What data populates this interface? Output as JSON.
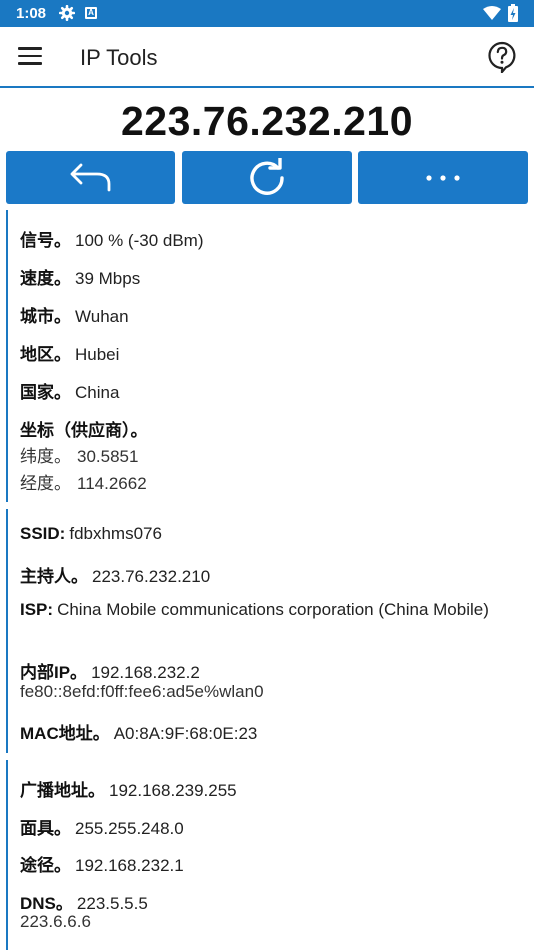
{
  "status_bar": {
    "time": "1:08",
    "icons": [
      "gear-icon",
      "a-notification-icon",
      "wifi-icon",
      "battery-icon"
    ]
  },
  "app_bar": {
    "title": "IP Tools",
    "menu_icon": "hamburger-menu-icon",
    "help_icon": "help-bubble-icon"
  },
  "ip_address": "223.76.232.210",
  "actions": [
    {
      "name": "back",
      "icon": "undo-arrow-icon"
    },
    {
      "name": "refresh",
      "icon": "refresh-icon"
    },
    {
      "name": "more",
      "icon": "more-dots-icon"
    }
  ],
  "colors": {
    "accent": "#1a78c2",
    "button": "#1b79c8"
  },
  "info": {
    "signal": {
      "label": "信号。",
      "value": "100 % (-30 dBm)"
    },
    "speed": {
      "label": "速度。",
      "value": "39 Mbps"
    },
    "city": {
      "label": "城市。",
      "value": "Wuhan"
    },
    "region": {
      "label": "地区。",
      "value": "Hubei"
    },
    "country": {
      "label": "国家。",
      "value": "China"
    },
    "coords": {
      "label": "坐标（供应商）。",
      "lat_label": "纬度。",
      "lat": "30.5851",
      "lon_label": "经度。",
      "lon": "114.2662"
    }
  },
  "network": {
    "ssid": {
      "label": "SSID:",
      "value": "fdbxhms076"
    },
    "host": {
      "label": "主持人。",
      "value": "223.76.232.210"
    },
    "isp": {
      "label": "ISP:",
      "value": "China Mobile communications corporation (China Mobile)"
    },
    "internal_ip": {
      "label": "内部IP。",
      "value": "192.168.232.2",
      "value2": "fe80::8efd:f0ff:fee6:ad5e%wlan0"
    },
    "mac": {
      "label": "MAC地址。",
      "value": "A0:8A:9F:68:0E:23"
    }
  },
  "lan": {
    "broadcast": {
      "label": "广播地址。",
      "value": "192.168.239.255"
    },
    "mask": {
      "label": "面具。",
      "value": "255.255.248.0"
    },
    "gateway": {
      "label": "途径。",
      "value": "192.168.232.1"
    },
    "dns": {
      "label": "DNS。",
      "value": "223.5.5.5",
      "value2": "223.6.6.6"
    }
  }
}
